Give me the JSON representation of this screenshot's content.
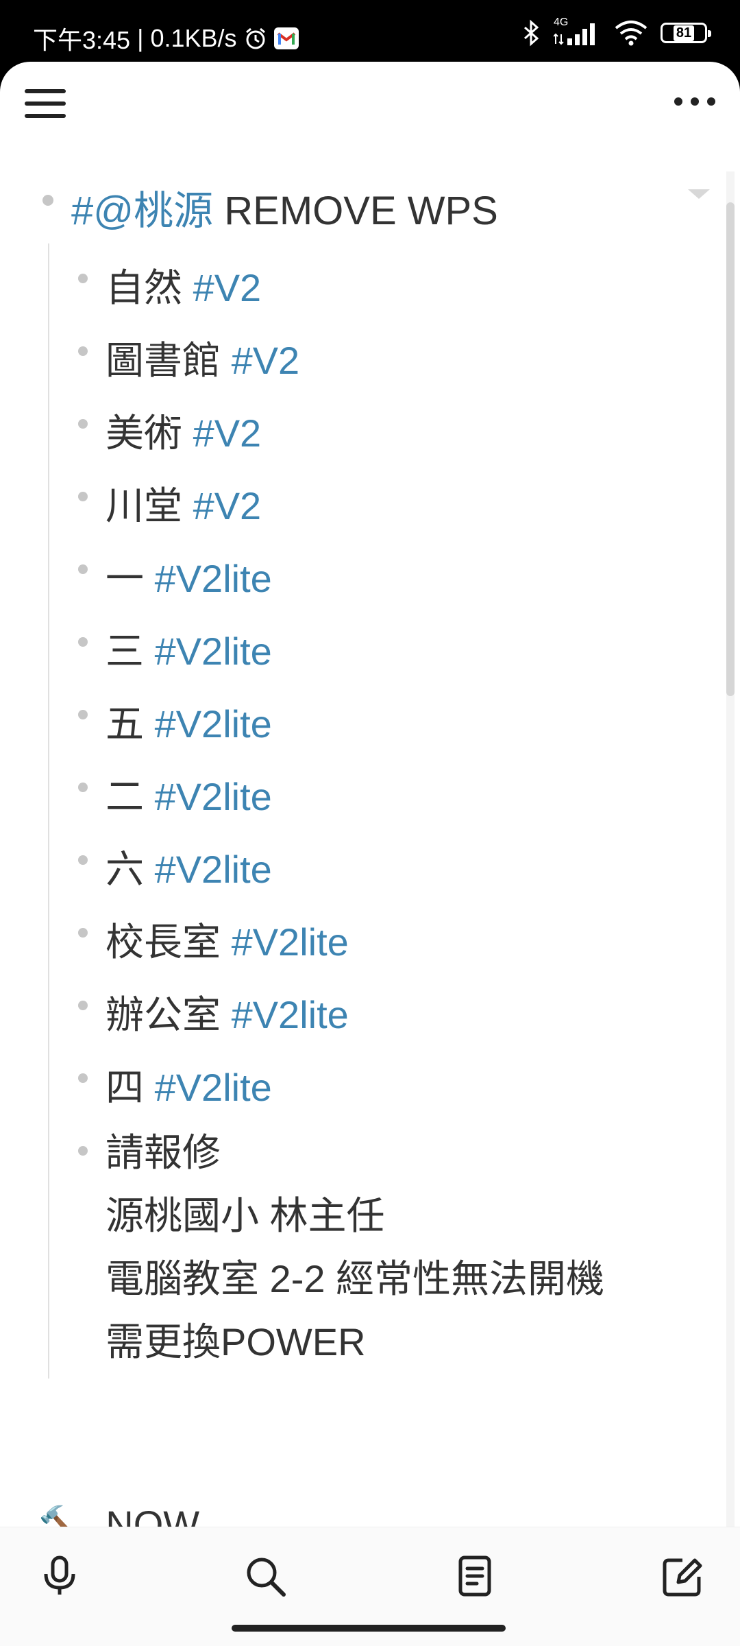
{
  "status_bar": {
    "time": "下午3:45",
    "separator": "|",
    "net_speed": "0.1KB/s",
    "network": "4G",
    "battery": "81"
  },
  "outline": {
    "parent": {
      "tag": "#@桃源",
      "text": "REMOVE WPS"
    },
    "children": [
      {
        "text": "自然",
        "tag": "#V2"
      },
      {
        "text": "圖書館",
        "tag": "#V2"
      },
      {
        "text": "美術",
        "tag": "#V2"
      },
      {
        "text": "川堂",
        "tag": "#V2"
      },
      {
        "text": "一",
        "tag": "#V2lite"
      },
      {
        "text": "三",
        "tag": "#V2lite"
      },
      {
        "text": "五",
        "tag": "#V2lite"
      },
      {
        "text": "二",
        "tag": "#V2lite"
      },
      {
        "text": "六",
        "tag": "#V2lite"
      },
      {
        "text": "校長室",
        "tag": "#V2lite"
      },
      {
        "text": "辦公室",
        "tag": "#V2lite"
      },
      {
        "text": "四",
        "tag": "#V2lite"
      }
    ],
    "note": {
      "line1": "請報修",
      "line2": "源桃國小 林主任",
      "line3": "電腦教室 2-2 經常性無法開機",
      "line4": "需更換POWER"
    },
    "next_section": "NOW"
  },
  "icons": {
    "menu": "hamburger-icon",
    "more": "more-horizontal-icon",
    "mic": "microphone-icon",
    "search": "search-icon",
    "notes": "document-icon",
    "compose": "edit-icon"
  }
}
